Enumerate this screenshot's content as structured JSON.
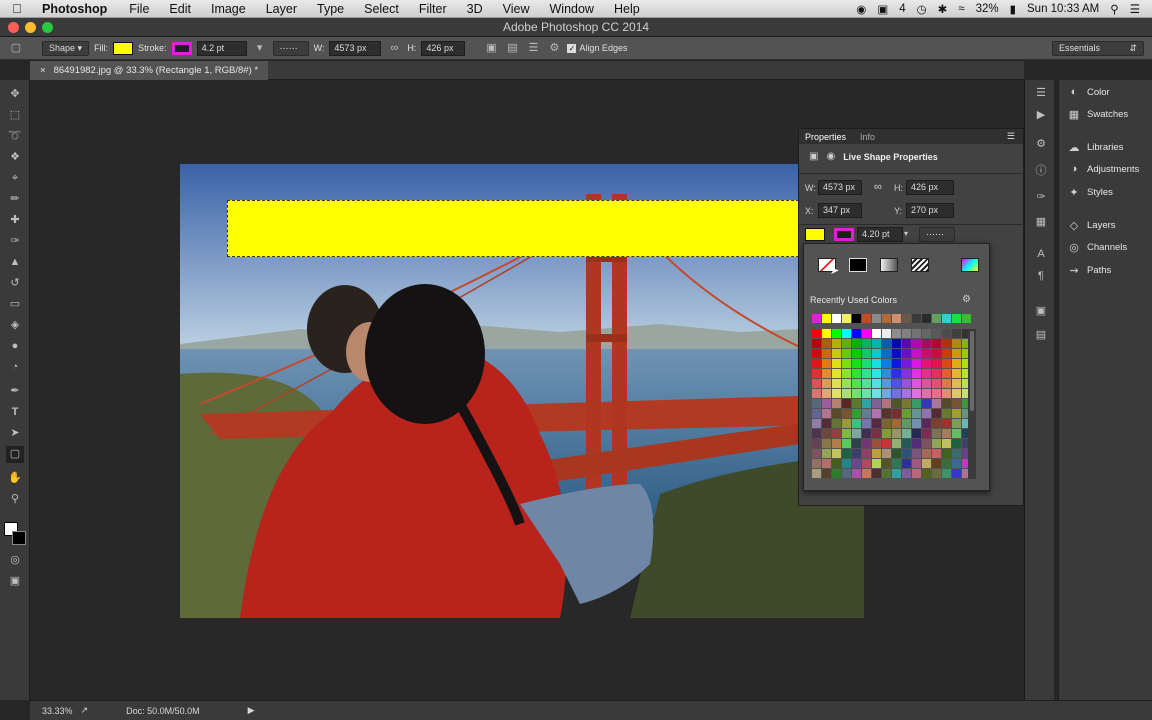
{
  "menubar": {
    "app_name": "Photoshop",
    "items": [
      "File",
      "Edit",
      "Image",
      "Layer",
      "Type",
      "Select",
      "Filter",
      "3D",
      "View",
      "Window",
      "Help"
    ],
    "status_battery": "32%",
    "status_clock": "Sun 10:33 AM",
    "status_adobe_count": "4"
  },
  "window": {
    "title": "Adobe Photoshop CC 2014"
  },
  "options": {
    "mode": "Shape",
    "fill_label": "Fill:",
    "stroke_label": "Stroke:",
    "stroke_width": "4.2 pt",
    "w_label": "W:",
    "w_value": "4573 px",
    "h_label": "H:",
    "h_value": "426 px",
    "align_edges": "Align Edges",
    "workspace": "Essentials",
    "fill_color": "#ffff00",
    "stroke_color": "#e020d8"
  },
  "document": {
    "tab": "86491982.jpg @ 33.3% (Rectangle 1, RGB/8#) *",
    "close": "×"
  },
  "right_panel": {
    "group1": [
      "Color",
      "Swatches"
    ],
    "group2": [
      "Libraries",
      "Adjustments",
      "Styles"
    ],
    "group3": [
      "Layers",
      "Channels",
      "Paths"
    ]
  },
  "properties": {
    "tabs": [
      "Properties",
      "Info"
    ],
    "section": "Live Shape Properties",
    "w_label": "W:",
    "w_value": "4573 px",
    "h_label": "H:",
    "h_value": "426 px",
    "x_label": "X:",
    "x_value": "347 px",
    "y_label": "Y:",
    "y_value": "270 px",
    "stroke_width": "4.20 pt"
  },
  "picker": {
    "title": "Recently Used Colors"
  },
  "status": {
    "zoom": "33.33%",
    "doc": "Doc: 50.0M/50.0M"
  }
}
